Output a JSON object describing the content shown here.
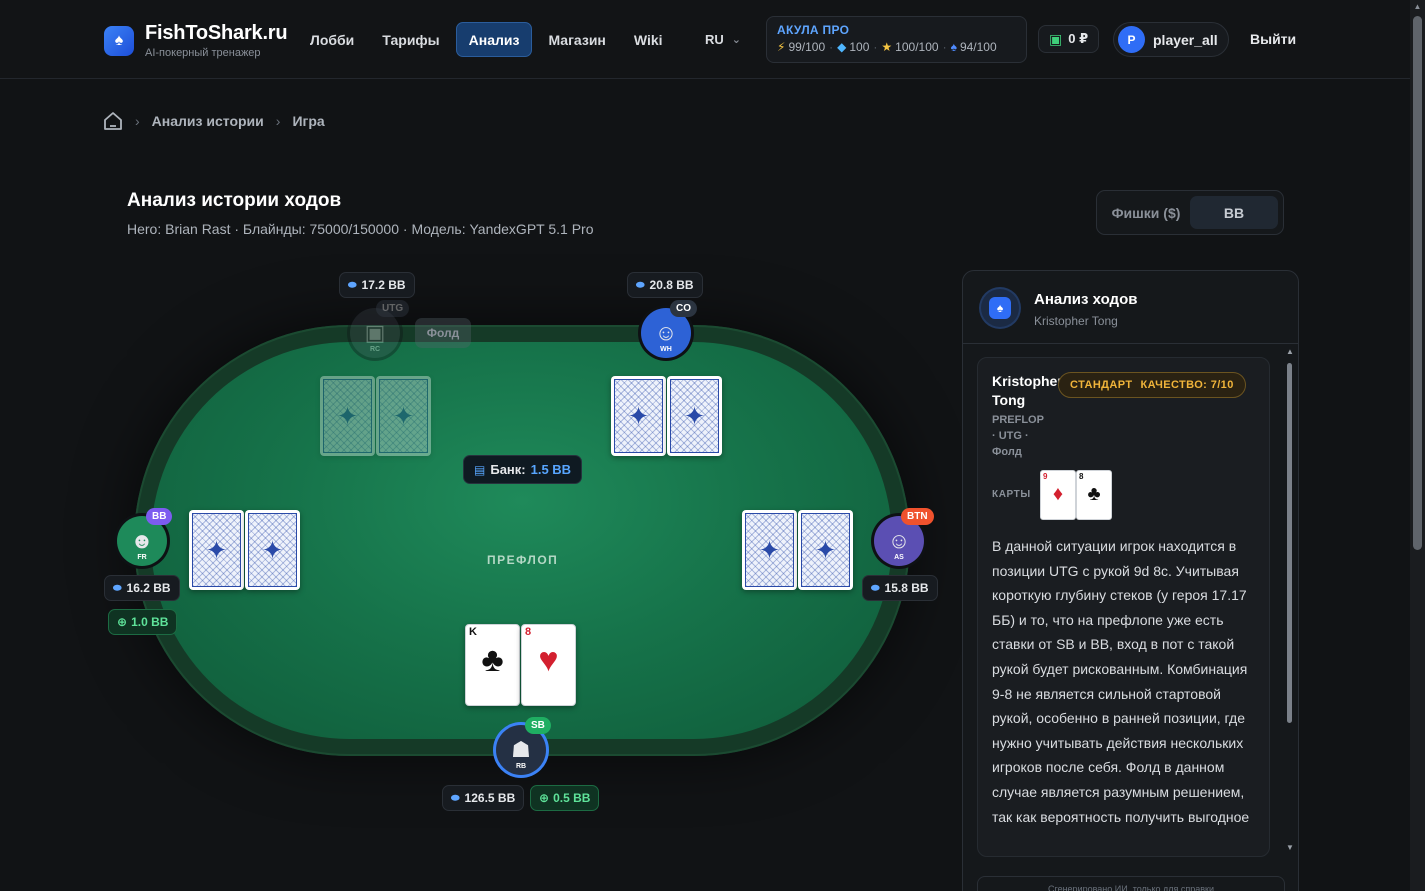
{
  "brand": {
    "name": "FishToShark.ru",
    "tagline": "AI-покерный тренажер"
  },
  "nav": [
    {
      "label": "Лобби",
      "active": false
    },
    {
      "label": "Тарифы",
      "active": false
    },
    {
      "label": "Анализ",
      "active": true
    },
    {
      "label": "Магазин",
      "active": false
    },
    {
      "label": "Wiki",
      "active": false
    }
  ],
  "language": "RU",
  "subscription": {
    "title": "АКУЛА ПРО",
    "stats": [
      {
        "icon": "lightning-icon",
        "value": "99/100"
      },
      {
        "icon": "diamond-icon",
        "value": "100"
      },
      {
        "icon": "star-icon",
        "value": "100/100"
      },
      {
        "icon": "spade-icon",
        "value": "94/100"
      }
    ]
  },
  "wallet": {
    "balance": "0 ₽"
  },
  "user": {
    "initial": "P",
    "name": "player_all"
  },
  "logout_label": "Выйти",
  "breadcrumb": [
    "Анализ истории",
    "Игра"
  ],
  "page": {
    "title": "Анализ истории ходов",
    "subtitle": "Hero: Brian Rast · Блайнды: 75000/150000 · Модель: YandexGPT 5.1 Pro"
  },
  "units_toggle": {
    "options": [
      "Фишки ($)",
      "BB"
    ],
    "selected": "BB"
  },
  "table": {
    "pot_label": "Банк:",
    "pot_value": "1.5 BB",
    "street": "ПРЕФЛОП",
    "fold_label": "Фолд",
    "seats": [
      {
        "pos": "UTG",
        "initials": "RC",
        "stack": "17.2 BB",
        "folded": true,
        "avatar_color": "#3a4048",
        "badge_color": "#3a4350"
      },
      {
        "pos": "CO",
        "initials": "WH",
        "stack": "20.8 BB",
        "folded": false,
        "avatar_color": "#2d62d6",
        "badge_color": "#2b3440"
      },
      {
        "pos": "BB",
        "initials": "FR",
        "stack": "16.2 BB",
        "bet": "1.0 BB",
        "folded": false,
        "avatar_color": "#1e8a5a",
        "badge_color": "#7c5cf0"
      },
      {
        "pos": "BTN",
        "initials": "AS",
        "stack": "15.8 BB",
        "folded": false,
        "avatar_color": "#5b4fb3",
        "badge_color": "#f0522d"
      },
      {
        "pos": "SB",
        "initials": "RB",
        "stack": "126.5 BB",
        "bet": "0.5 BB",
        "folded": false,
        "avatar_color": "#243044",
        "badge_color": "#1fae62"
      }
    ],
    "hero_cards": [
      {
        "rank": "K",
        "suit": "♣",
        "color": "black"
      },
      {
        "rank": "8",
        "suit": "♥",
        "color": "red"
      }
    ]
  },
  "analysis_panel": {
    "title": "Анализ ходов",
    "player": "Kristopher Tong",
    "entry": {
      "name": "Kristopher Tong",
      "level": "СТАНДАРТ",
      "quality": "КАЧЕСТВО: 7/10",
      "street": "PREFLOP",
      "position": "· UTG ·",
      "action": "Фолд",
      "cards_label": "КАРТЫ",
      "cards": [
        {
          "rank": "9",
          "suit": "♦",
          "color": "red"
        },
        {
          "rank": "8",
          "suit": "♣",
          "color": "black"
        }
      ],
      "text": "В данной ситуации игрок находится в позиции UTG с рукой 9d 8c. Учитывая короткую глубину стеков (у героя 17.17 ББ) и то, что на префлопе уже есть ставки от SB и BB, вход в пот с такой рукой будет рискованным. Комбинация 9-8 не является сильной стартовой рукой, особенно в ранней позиции, где нужно учитывать действия нескольких игроков после себя. Фолд в данном случае является разумным решением, так как вероятность получить выгодное"
    },
    "footer": "Сгенерировано ИИ, только для справки"
  }
}
